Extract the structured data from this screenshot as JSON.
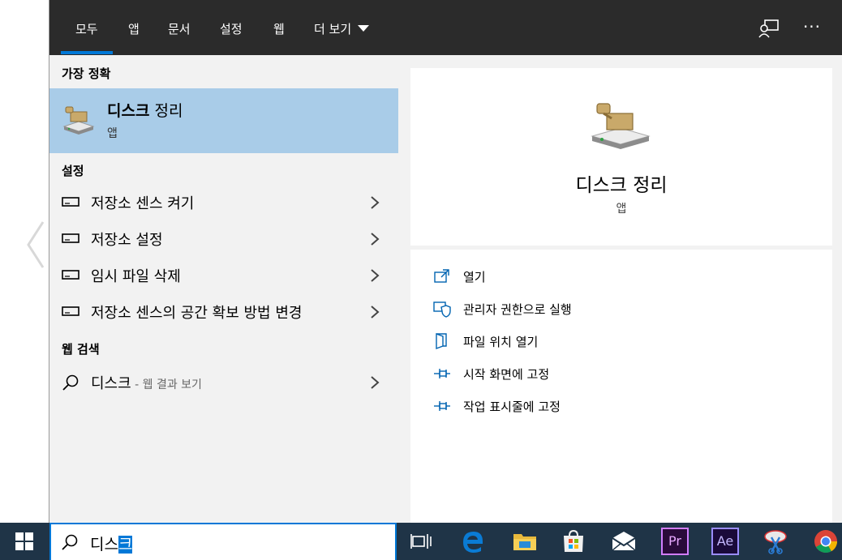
{
  "tabs": {
    "all": "모두",
    "apps": "앱",
    "documents": "문서",
    "settings": "설정",
    "web": "웹",
    "more": "더 보기"
  },
  "results": {
    "best_match_header": "가장 정확",
    "best_match": {
      "title_bold": "디스크",
      "title_rest": " 정리",
      "subtitle": "앱"
    },
    "settings_header": "설정",
    "settings_items": [
      {
        "label": "저장소 센스 켜기"
      },
      {
        "label": "저장소 설정"
      },
      {
        "label": "임시 파일 삭제"
      },
      {
        "label": "저장소 센스의 공간 확보 방법 변경"
      }
    ],
    "web_header": "웹 검색",
    "web_item": {
      "term": "디스크",
      "suffix": " - 웹 결과 보기"
    }
  },
  "preview": {
    "title": "디스크 정리",
    "subtitle": "앱",
    "actions": [
      {
        "label": "열기",
        "icon": "open-external-icon"
      },
      {
        "label": "관리자 권한으로 실행",
        "icon": "shield-icon"
      },
      {
        "label": "파일 위치 열기",
        "icon": "file-location-icon"
      },
      {
        "label": "시작 화면에 고정",
        "icon": "pin-icon"
      },
      {
        "label": "작업 표시줄에 고정",
        "icon": "pin-icon"
      }
    ]
  },
  "taskbar": {
    "search_typed": "디스",
    "search_selected": "크",
    "pinned": [
      "task-view-icon",
      "edge-icon",
      "file-explorer-icon",
      "store-icon",
      "mail-icon",
      "premiere-icon",
      "after-effects-icon",
      "snipping-tool-icon",
      "chrome-icon"
    ],
    "premiere_text": "Pr",
    "after_effects_text": "Ae"
  },
  "colors": {
    "accent": "#0078d7",
    "selection": "#a9cce8",
    "topbar": "#2b2b2b",
    "taskbar": "#1f3447"
  }
}
